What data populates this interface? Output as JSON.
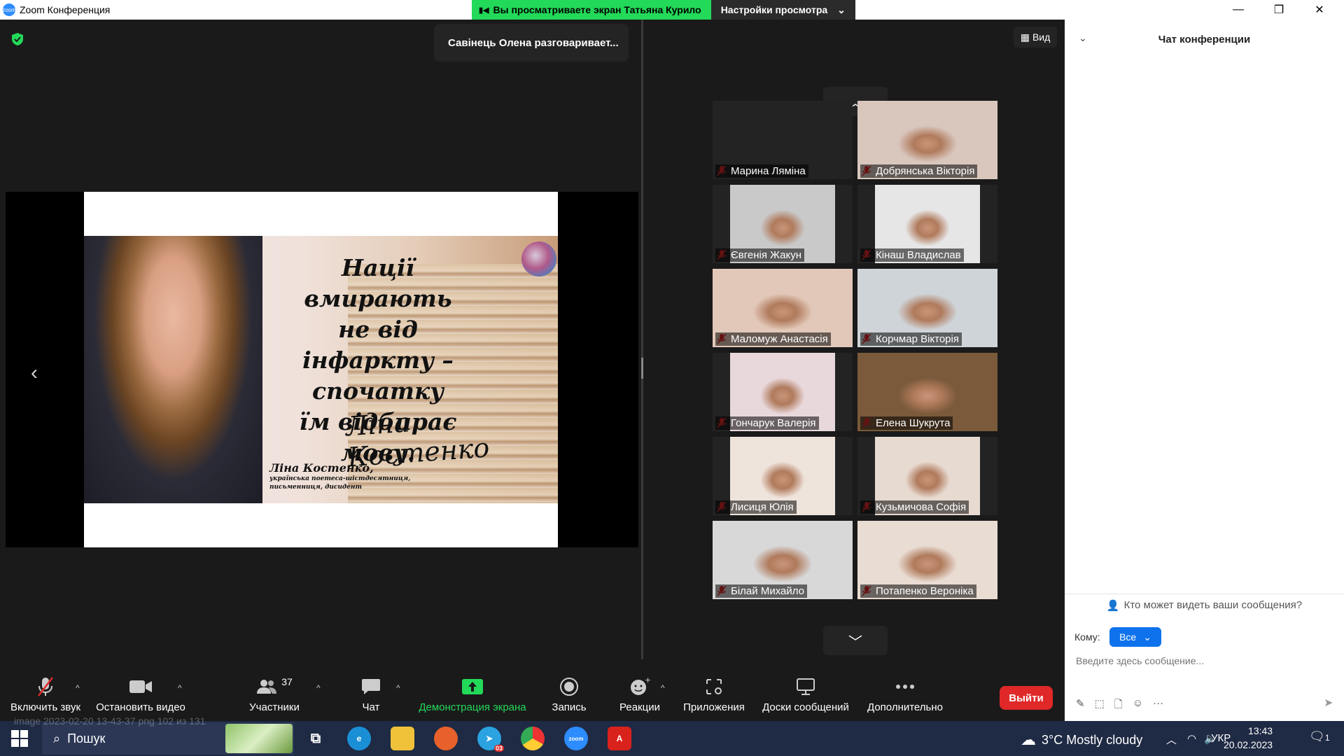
{
  "window": {
    "title": "Zoom Конференция",
    "share_banner": "Вы просматриваете экран Татьяна Курило",
    "view_settings": "Настройки просмотра",
    "controls": [
      "—",
      "❐",
      "✕"
    ]
  },
  "meeting": {
    "talking_indicator": "Савінець Олена разговаривает...",
    "view_label": "Вид",
    "slide": {
      "quote_lines": [
        "Нації вмирають",
        "не від інфаркту –",
        "спочатку",
        "їм відбирає мову."
      ],
      "signature": "Ліна Костенко",
      "author_name": "Ліна Костенко,",
      "author_desc": [
        "українська поетеса-шістдесятниця,",
        "письменниця, дисидент"
      ]
    },
    "participants": [
      {
        "name": "Марина Ляміна",
        "video": "none"
      },
      {
        "name": "Добрянська Вікторія",
        "video": "#d9c7be"
      },
      {
        "name": "Євгенія Жакун",
        "video": "#c9c9c9"
      },
      {
        "name": "Кінаш Владислав",
        "video": "#e6e6e6"
      },
      {
        "name": "Маломуж Анастасія",
        "video": "#e2c8b8"
      },
      {
        "name": "Корчмар Вікторія",
        "video": "#cfd4d8"
      },
      {
        "name": "Гончарук Валерія",
        "video": "#e8d8dc"
      },
      {
        "name": "Елена Шукрута",
        "video": "#7a5a3a"
      },
      {
        "name": "Лисиця Юлія",
        "video": "#efe4dc"
      },
      {
        "name": "Кузьмичова Софія",
        "video": "#e7dad0"
      },
      {
        "name": "Білай Михайло",
        "video": "#d8d8d8"
      },
      {
        "name": "Потапенко Вероніка",
        "video": "#e9dcd2"
      }
    ]
  },
  "toolbar": {
    "unmute": "Включить звук",
    "stop_video": "Остановить видео",
    "participants": "Участники",
    "participants_count": "37",
    "chat": "Чат",
    "share": "Демонстрация экрана",
    "record": "Запись",
    "reactions": "Реакции",
    "apps": "Приложения",
    "whiteboards": "Доски сообщений",
    "more": "Дополнительно",
    "leave": "Выйти"
  },
  "chat": {
    "title": "Чат конференции",
    "who_can_see": "Кто может видеть ваши сообщения?",
    "to_label": "Кому:",
    "to_value": "Все",
    "placeholder": "Введите здесь сообщение..."
  },
  "taskbar": {
    "search": "Пошук",
    "telegram_badge": "03",
    "weather": "3°C  Mostly cloudy",
    "lang": "УКР",
    "time": "13:43",
    "date": "20.02.2023",
    "notif_count": "1"
  },
  "watermark": "image 2023-02-20 13-43-37 png 102 из 131"
}
